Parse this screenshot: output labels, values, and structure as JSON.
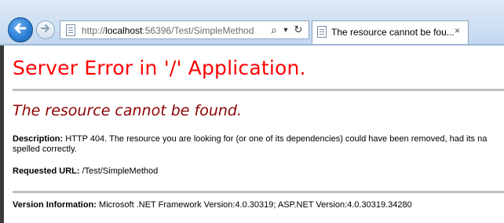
{
  "browser": {
    "address": {
      "prefix": "http://",
      "host": "localhost",
      "rest": ":56396/Test/SimpleMethod"
    },
    "tab": {
      "title": "The resource cannot be fou...",
      "close": "×"
    },
    "icons": {
      "back": "back-arrow-icon",
      "forward": "forward-arrow-icon",
      "search": "search-icon",
      "dropdown": "dropdown-icon",
      "refresh": "refresh-icon",
      "page": "page-icon"
    }
  },
  "page": {
    "title": "Server Error in '/' Application.",
    "subtitle": "The resource cannot be found.",
    "description": {
      "label": "Description:",
      "text_line1": "HTTP 404. The resource you are looking for (or one of its dependencies) could have been removed, had its na",
      "text_line2": "spelled correctly."
    },
    "requested_url": {
      "label": "Requested URL:",
      "value": "/Test/SimpleMethod"
    },
    "version": {
      "label": "Version Information:",
      "value": "Microsoft .NET Framework Version:4.0.30319; ASP.NET Version:4.0.30319.34280"
    }
  },
  "colors": {
    "title": "#ff0000",
    "subtitle": "#8b0000",
    "rule": "#c0c0c0",
    "chrome": "#cddff2"
  }
}
